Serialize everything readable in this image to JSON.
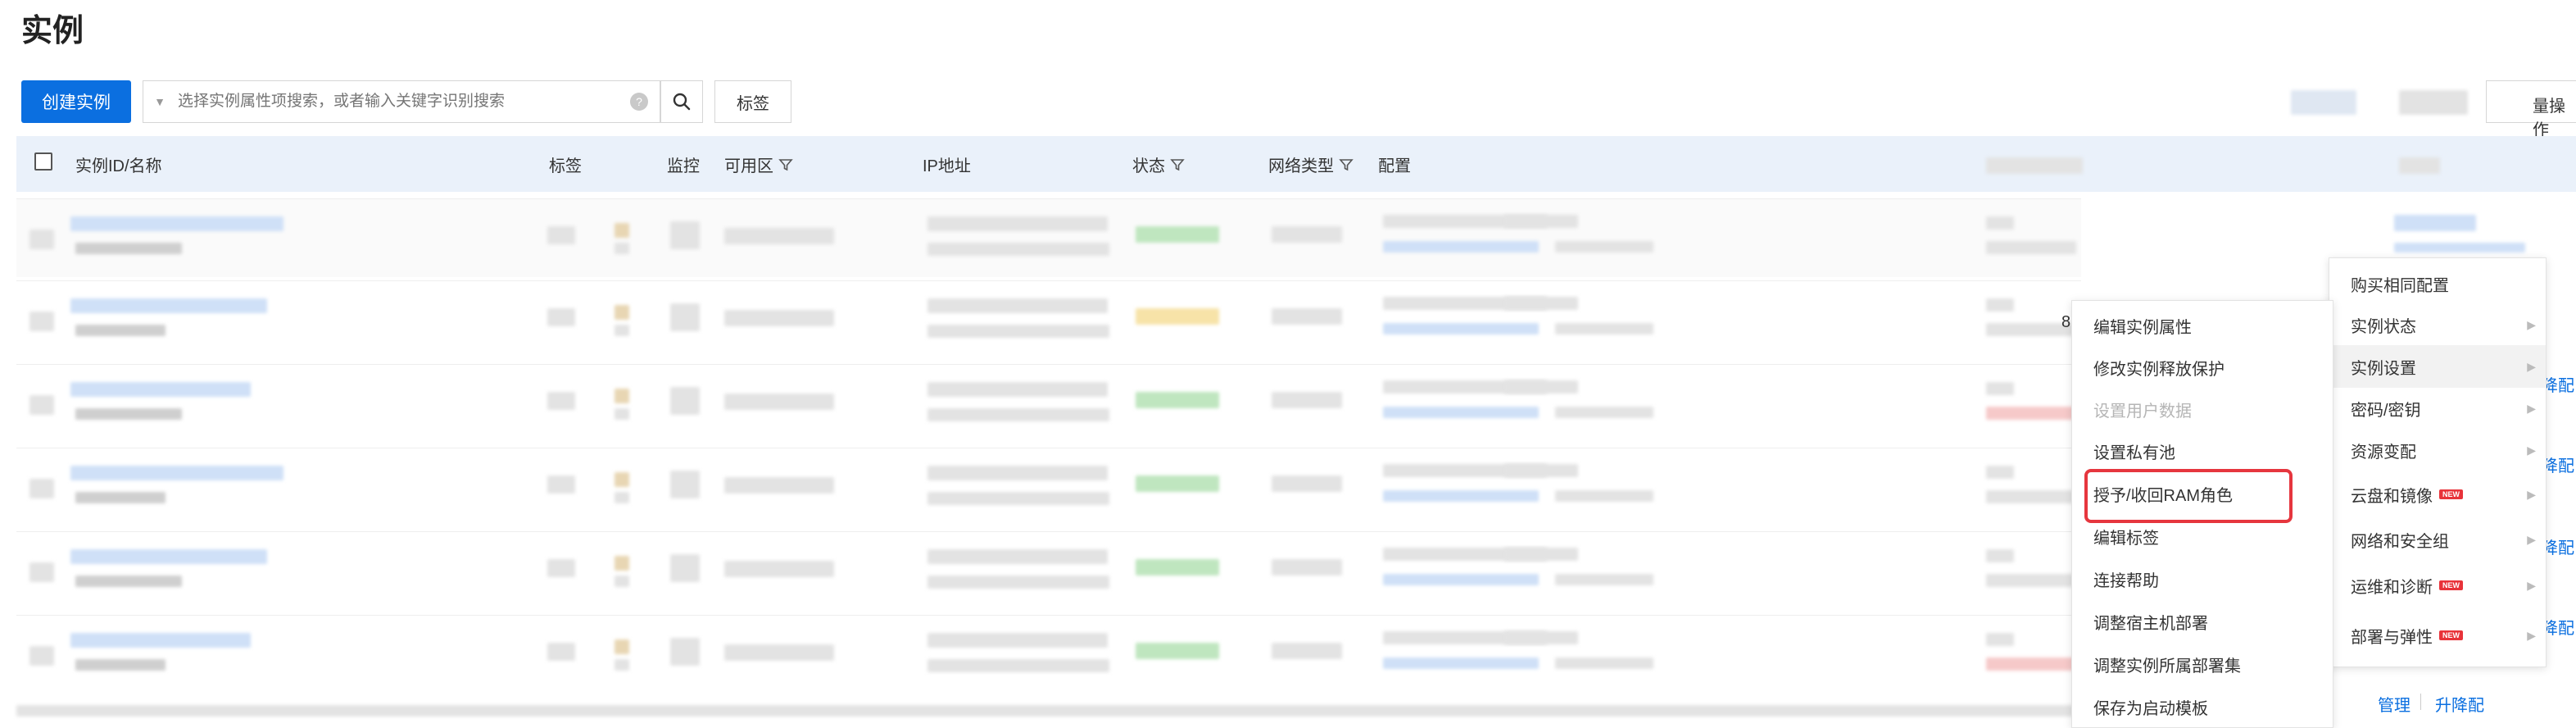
{
  "page": {
    "title": "实例"
  },
  "toolbar": {
    "create_label": "创建实例",
    "search_placeholder": "选择实例属性项搜索，或者输入关键字识别搜索",
    "help_glyph": "?",
    "tag_label": "标签",
    "batch_partial": "量操作"
  },
  "table": {
    "headers": {
      "id_name": "实例ID/名称",
      "tags": "标签",
      "monitor": "监控",
      "zone": "可用区",
      "ip": "IP地址",
      "status": "状态",
      "network": "网络类型",
      "config": "配置"
    },
    "partial_char": "8"
  },
  "actions": {
    "manage": "管理",
    "upgrade": "升降配",
    "upgrade_partial": "降配"
  },
  "menu_main": {
    "items": [
      {
        "label": "购买相同配置",
        "arrow": false,
        "new": false
      },
      {
        "label": "实例状态",
        "arrow": true,
        "new": false
      },
      {
        "label": "实例设置",
        "arrow": true,
        "new": false
      },
      {
        "label": "密码/密钥",
        "arrow": true,
        "new": false
      },
      {
        "label": "资源变配",
        "arrow": true,
        "new": false
      },
      {
        "label": "云盘和镜像",
        "arrow": true,
        "new": true
      },
      {
        "label": "网络和安全组",
        "arrow": true,
        "new": false
      },
      {
        "label": "运维和诊断",
        "arrow": true,
        "new": true
      },
      {
        "label": "部署与弹性",
        "arrow": true,
        "new": true
      }
    ],
    "new_badge": "NEW"
  },
  "menu_sub": {
    "items": [
      {
        "label": "编辑实例属性",
        "disabled": false
      },
      {
        "label": "修改实例释放保护",
        "disabled": false
      },
      {
        "label": "设置用户数据",
        "disabled": true
      },
      {
        "label": "设置私有池",
        "disabled": false
      },
      {
        "label": "授予/收回RAM角色",
        "disabled": false
      },
      {
        "label": "编辑标签",
        "disabled": false
      },
      {
        "label": "连接帮助",
        "disabled": false
      },
      {
        "label": "调整宿主机部署",
        "disabled": false
      },
      {
        "label": "调整实例所属部署集",
        "disabled": false
      },
      {
        "label": "保存为启动模板",
        "disabled": false
      }
    ]
  },
  "colors": {
    "primary": "#0b6fe0",
    "highlight": "#e6363e",
    "badge": "#e8333a"
  }
}
